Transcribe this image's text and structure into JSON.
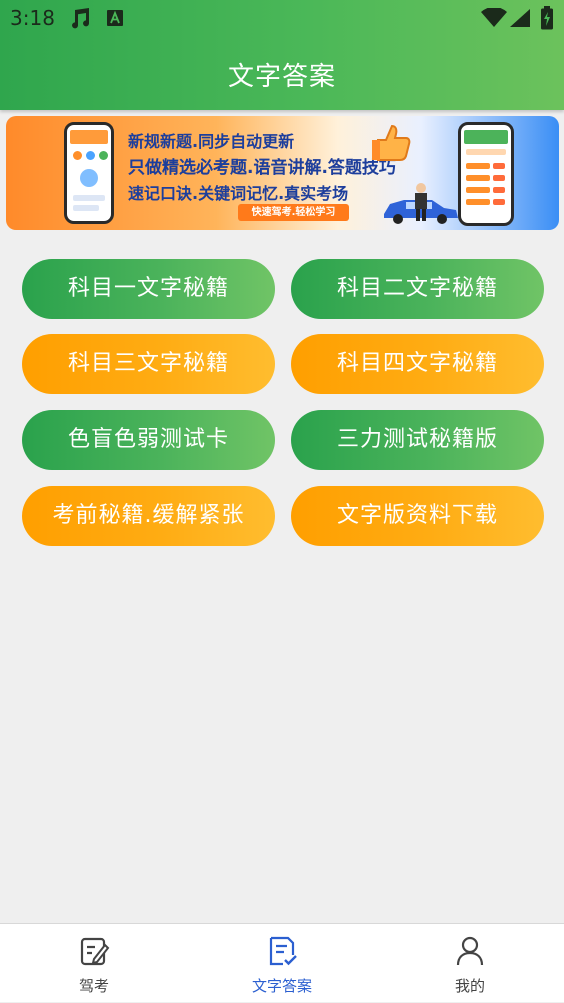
{
  "status_bar": {
    "time": "3:18",
    "icons": [
      "music-note-icon",
      "keyboard-icon",
      "wifi-icon",
      "signal-icon",
      "battery-icon"
    ]
  },
  "header": {
    "title": "文字答案"
  },
  "banner": {
    "line1": "新规新题.同步自动更新",
    "line2": "只做精选必考题.语音讲解.答题技巧",
    "line3": "速记口诀.关键词记忆.真实考场",
    "tag": "快速驾考.轻松学习"
  },
  "buttons": [
    {
      "label": "科目一文字秘籍",
      "color": "green"
    },
    {
      "label": "科目二文字秘籍",
      "color": "green"
    },
    {
      "label": "科目三文字秘籍",
      "color": "orange"
    },
    {
      "label": "科目四文字秘籍",
      "color": "orange"
    },
    {
      "label": "色盲色弱测试卡",
      "color": "green"
    },
    {
      "label": "三力测试秘籍版",
      "color": "green"
    },
    {
      "label": "考前秘籍.缓解紧张",
      "color": "orange"
    },
    {
      "label": "文字版资料下载",
      "color": "orange"
    }
  ],
  "bottom_nav": {
    "tabs": [
      {
        "label": "驾考",
        "icon": "exam-edit-icon",
        "active": false
      },
      {
        "label": "文字答案",
        "icon": "document-check-icon",
        "active": true
      },
      {
        "label": "我的",
        "icon": "person-icon",
        "active": false
      }
    ]
  },
  "colors": {
    "header_green": "#4bb858",
    "button_green": "#2aa24c",
    "button_orange": "#ffa60a",
    "active_tab_blue": "#2b5fd0"
  }
}
